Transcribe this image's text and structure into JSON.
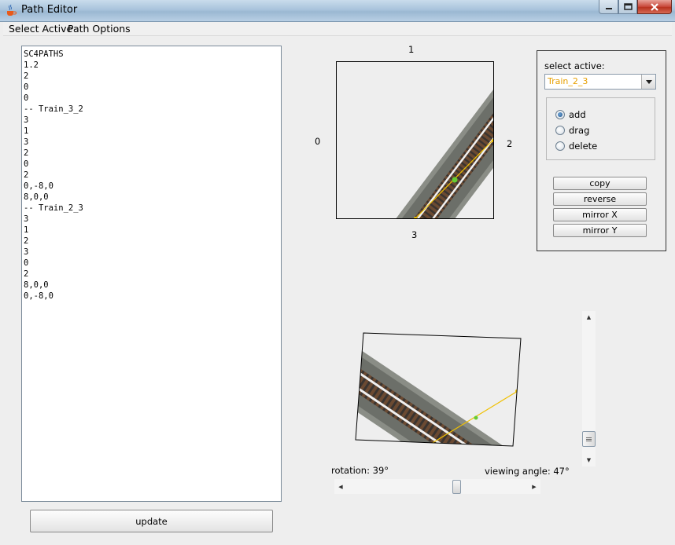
{
  "window": {
    "title": "Path Editor",
    "icons": {
      "app": "java-cup-icon",
      "minimize": "minimize-icon",
      "maximize": "maximize-icon",
      "close": "close-icon"
    }
  },
  "menu": [
    "Select Active",
    "Path Options"
  ],
  "editor": {
    "text": "SC4PATHS\n1.2\n2\n0\n0\n-- Train_3_2\n3\n1\n3\n2\n0\n2\n0,-8,0\n8,0,0\n-- Train_2_3\n3\n1\n2\n3\n0\n2\n8,0,0\n0,-8,0"
  },
  "update_button": "update",
  "top_view": {
    "side_labels": {
      "top": "1",
      "left": "0",
      "right": "2",
      "bottom": "3"
    }
  },
  "panel": {
    "select_label": "select active:",
    "select_value": "Train_2_3",
    "modes": [
      {
        "label": "add",
        "checked": true
      },
      {
        "label": "drag",
        "checked": false
      },
      {
        "label": "delete",
        "checked": false
      }
    ],
    "buttons": [
      "copy",
      "reverse",
      "mirror X",
      "mirror Y"
    ]
  },
  "view_controls": {
    "rotation_label": "rotation: 39°",
    "viewing_angle_label": "viewing angle: 47°",
    "rotation_deg": 39,
    "viewing_angle_deg": 47
  },
  "colors": {
    "path_line": "#f0c000",
    "path_node": "#66cc33",
    "selected_text": "#e8a000"
  }
}
